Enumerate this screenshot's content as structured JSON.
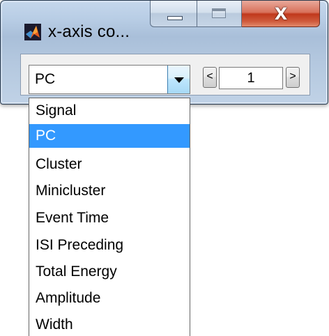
{
  "window": {
    "title": "x-axis co...",
    "close_glyph": "X"
  },
  "icons": {
    "app": "matlab-logo-icon",
    "minimize": "minimize-icon",
    "maximize": "maximize-icon",
    "close": "close-icon",
    "dropdown_arrow": "chevron-down-icon"
  },
  "colors": {
    "selection": "#3399ff",
    "close_button": "#c0381c"
  },
  "axis_select": {
    "value": "PC",
    "options": [
      "Signal",
      "PC",
      "Cluster",
      "Minicluster",
      "Event Time",
      "ISI Preceding",
      "Total Energy",
      "Amplitude",
      "Width"
    ],
    "selected_index": 1
  },
  "index_control": {
    "prev_label": "<",
    "value": "1",
    "next_label": ">"
  }
}
